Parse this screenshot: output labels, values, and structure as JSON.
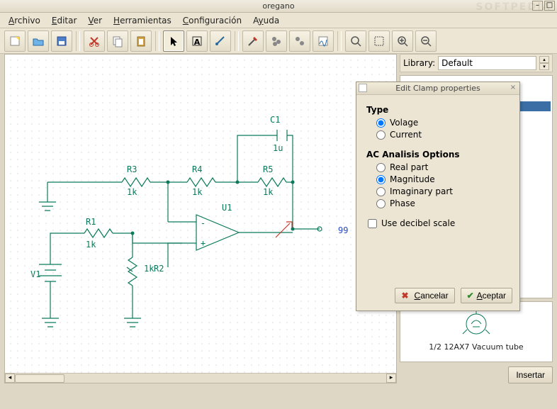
{
  "window": {
    "title": "oregano"
  },
  "watermark": "SOFTPEDIA",
  "menu": {
    "items": [
      "Archivo",
      "Editar",
      "Ver",
      "Herramientas",
      "Configuración",
      "Ayuda"
    ]
  },
  "library": {
    "label": "Library:",
    "selected": "Default"
  },
  "preview": {
    "caption": "1/2 12AX7 Vacuum tube"
  },
  "insert_label": "Insertar",
  "dialog": {
    "title": "Edit Clamp properties",
    "type_section": "Type",
    "type_options": [
      "Volage",
      "Current"
    ],
    "type_selected": 0,
    "ac_section": "AC Analisis Options",
    "ac_options": [
      "Real part",
      "Magnitude",
      "Imaginary part",
      "Phase"
    ],
    "ac_selected": 1,
    "decibel_label": "Use decibel scale",
    "decibel_checked": false,
    "cancel_label": "Cancelar",
    "accept_label": "Aceptar"
  },
  "schematic": {
    "components": [
      {
        "ref": "C1",
        "value": "1u"
      },
      {
        "ref": "R3",
        "value": "1k"
      },
      {
        "ref": "R4",
        "value": "1k"
      },
      {
        "ref": "R5",
        "value": "1k"
      },
      {
        "ref": "R1",
        "value": "1k"
      },
      {
        "ref": "R2",
        "value": "1k"
      },
      {
        "ref": "U1",
        "value": ""
      },
      {
        "ref": "V1",
        "value": ""
      }
    ],
    "net_label": "99"
  }
}
